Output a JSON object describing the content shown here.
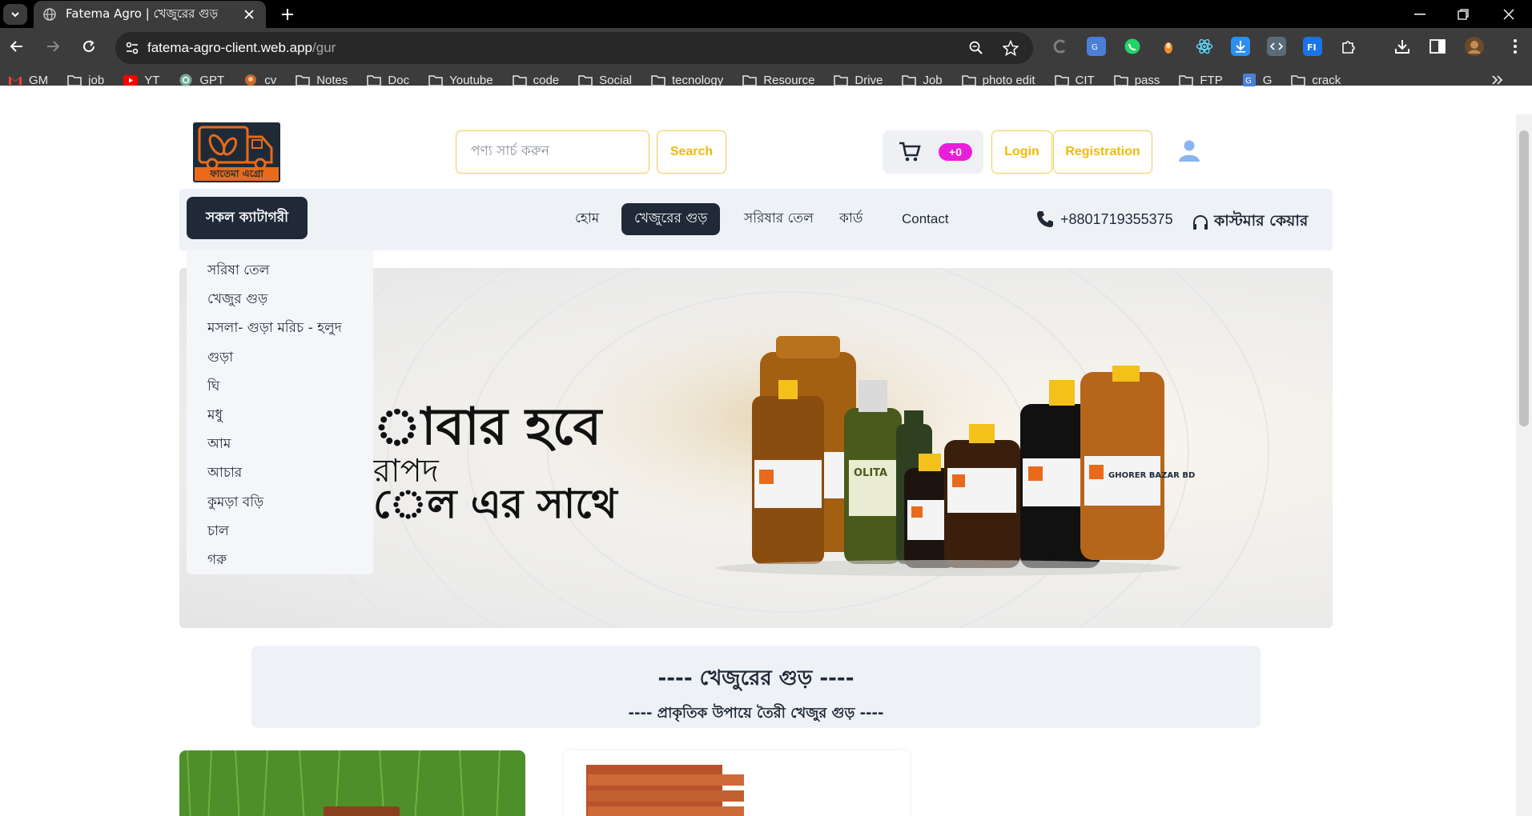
{
  "browser": {
    "tab_title": "Fatema Agro | খেজুরের গুড়",
    "url_host": "fatema-agro-client.web.app",
    "url_path": "/gur",
    "bookmarks": [
      "GM",
      "job",
      "YT",
      "GPT",
      "cv",
      "Notes",
      "Doc",
      "Youtube",
      "code",
      "Social",
      "tecnology",
      "Resource",
      "Drive",
      "Job",
      "photo edit",
      "CIT",
      "pass",
      "FTP",
      "G",
      "crack"
    ]
  },
  "header": {
    "logo_text": "ফাতেমা এগ্রো",
    "search_placeholder": "পণ্য সার্চ করুন",
    "search_label": "Search",
    "cart_count": "+0",
    "login_label": "Login",
    "registration_label": "Registration"
  },
  "nav": {
    "all_categories": "সকল ক্যাটাগরী",
    "items": [
      "হোম",
      "খেজুরের গুড়",
      "সরিষার তেল",
      "কার্ড",
      "Contact"
    ],
    "phone": "+8801719355375",
    "customer_care": "কাস্টমার কেয়ার"
  },
  "categories": [
    "সরিষা তেল",
    "খেজুর গুড়",
    "মসলা- গুড়া মরিচ - হলুদ",
    "গুড়া",
    "ঘি",
    "মধু",
    "আম",
    "আচার",
    "কুমড়া বড়ি",
    "চাল",
    "গরু"
  ],
  "hero": {
    "line1": "াবার হবে",
    "line2": "রাপদ",
    "line3": "েল এর সাথে",
    "bottle_brand": "GHORER BAZAR BD",
    "olive_label": "OLITA"
  },
  "section": {
    "title": "---- খেজুরের গুড় ----",
    "subtitle": "---- প্রাকৃতিক উপায়ে তৈরী খেজুর গুড় ----"
  },
  "colors": {
    "accent": "#f0b90b",
    "dark": "#1f2937",
    "badge": "#e91edb",
    "panel": "#eef2f7"
  }
}
